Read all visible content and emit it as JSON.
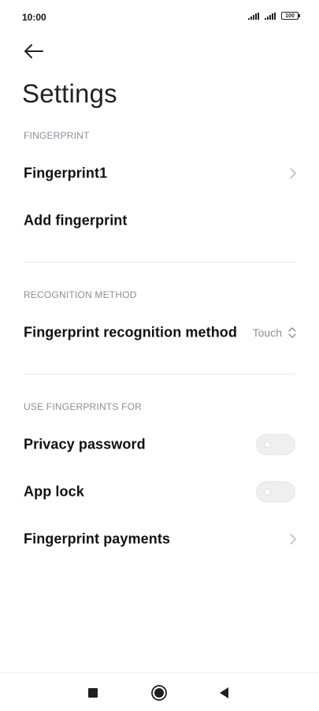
{
  "status_bar": {
    "time": "10:00",
    "battery": "100",
    "icons": [
      "signal-icon",
      "signal-icon",
      "battery-icon"
    ]
  },
  "header": {
    "back_icon": "back-arrow-icon",
    "title": "Settings"
  },
  "sections": {
    "fingerprint": {
      "header": "FINGERPRINT",
      "items": [
        {
          "label": "Fingerprint1",
          "icon": "chevron-right-icon"
        },
        {
          "label": "Add fingerprint"
        }
      ]
    },
    "recognition": {
      "header": "RECOGNITION METHOD",
      "item": {
        "label": "Fingerprint recognition method",
        "value": "Touch",
        "icon": "up-down-chevron-icon"
      }
    },
    "use_for": {
      "header": "USE FINGERPRINTS FOR",
      "items": [
        {
          "label": "Privacy password",
          "toggle": false
        },
        {
          "label": "App lock",
          "toggle": false
        },
        {
          "label": "Fingerprint payments",
          "icon": "chevron-right-icon"
        }
      ]
    }
  },
  "nav_bar": {
    "buttons": [
      "recents-square-icon",
      "home-circle-icon",
      "back-triangle-icon"
    ]
  },
  "colors": {
    "section_header": "#8a8f99",
    "divider": "#e6e6e6",
    "toggle_off": "#efefef",
    "nav_icon": "#1f1f1f"
  }
}
